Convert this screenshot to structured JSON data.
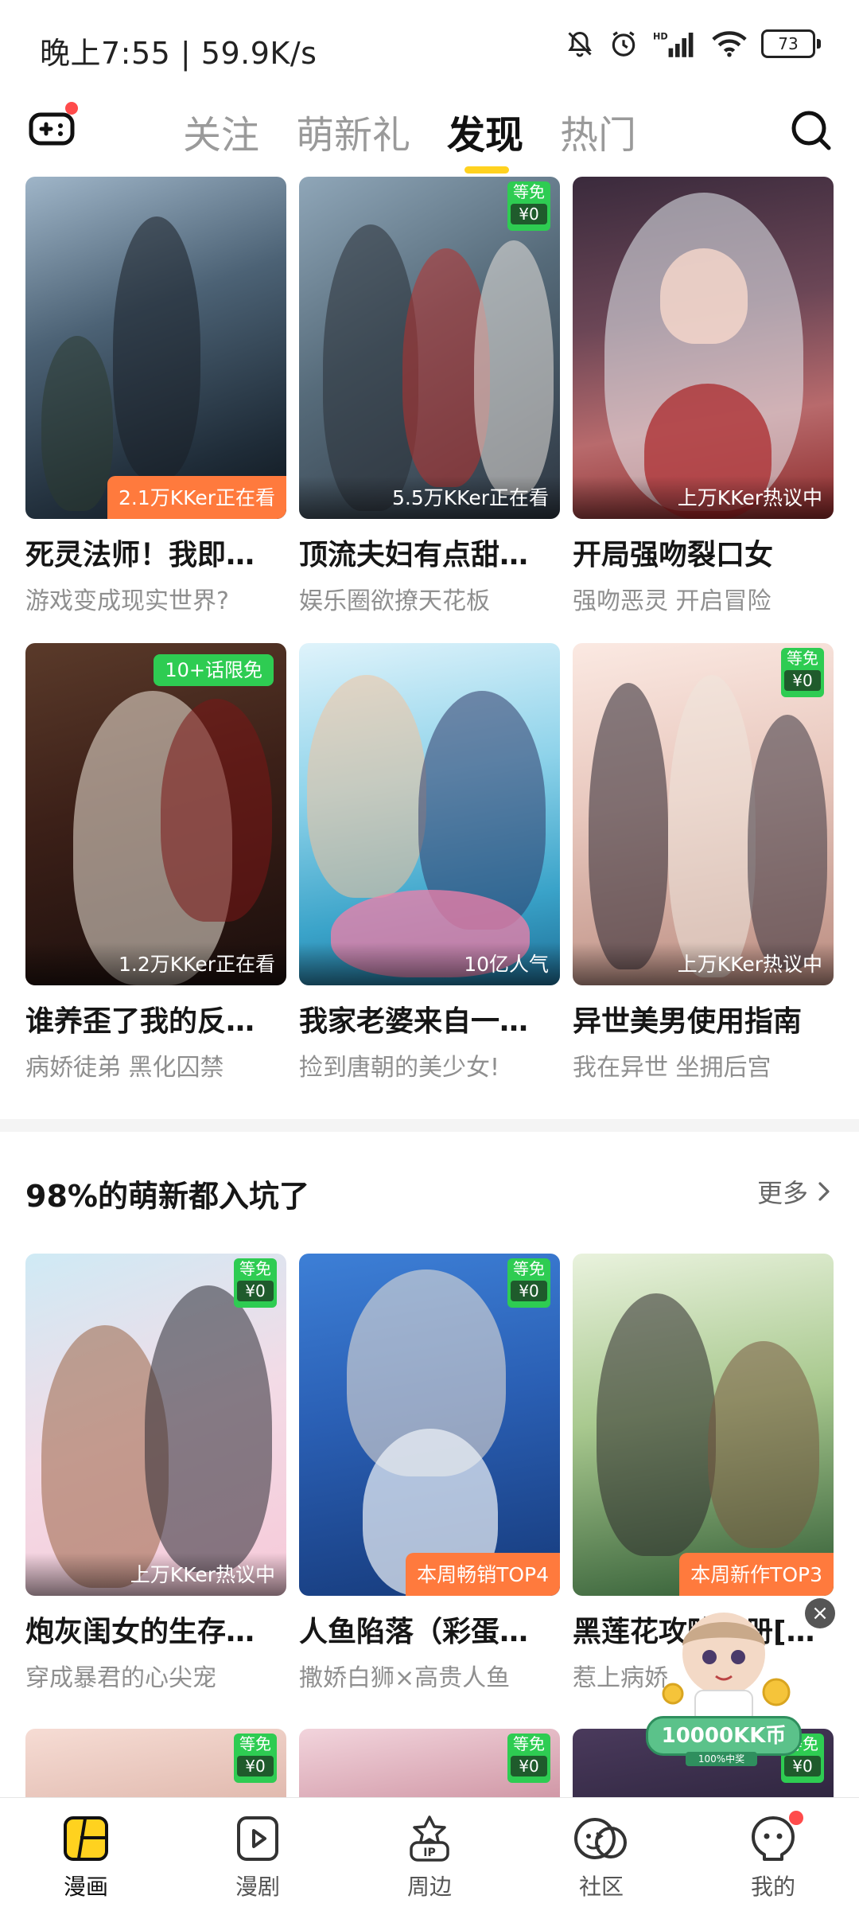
{
  "status_bar": {
    "time_speed": "晚上7:55 | 59.9K/s",
    "battery": "73"
  },
  "top_nav": {
    "tabs": [
      {
        "label": "关注"
      },
      {
        "label": "萌新礼"
      },
      {
        "label": "发现"
      },
      {
        "label": "热门"
      }
    ],
    "active_tab": "发现"
  },
  "grid": [
    {
      "title": "死灵法师！我即…",
      "subtitle": "游戏变成现实世界?",
      "watch_label": "2.1万KKer正在看",
      "label_style": "orange"
    },
    {
      "title": "顶流夫妇有点甜…",
      "subtitle": "娱乐圈欲撩天花板",
      "watch_label": "5.5万KKer正在看",
      "label_style": "plain",
      "free_top": "等免",
      "free_price": "¥0"
    },
    {
      "title": "开局强吻裂口女",
      "subtitle": "强吻恶灵 开启冒险",
      "watch_label": "上万KKer热议中",
      "label_style": "plain"
    },
    {
      "title": "谁养歪了我的反…",
      "subtitle": "病娇徒弟 黑化囚禁",
      "watch_label": "1.2万KKer正在看",
      "label_style": "plain",
      "limit_badge": "10+话限免"
    },
    {
      "title": "我家老婆来自一…",
      "subtitle": "捡到唐朝的美少女!",
      "watch_label": "10亿人气",
      "label_style": "plain"
    },
    {
      "title": "异世美男使用指南",
      "subtitle": "我在异世 坐拥后宫",
      "watch_label": "上万KKer热议中",
      "label_style": "plain",
      "free_top": "等免",
      "free_price": "¥0"
    }
  ],
  "section": {
    "title": "98%的萌新都入坑了",
    "more_label": "更多"
  },
  "section_cards": [
    {
      "title": "炮灰闺女的生存…",
      "subtitle": "穿成暴君的心尖宠",
      "watch_label": "上万KKer热议中",
      "label_style": "plain",
      "free_top": "等免",
      "free_price": "¥0"
    },
    {
      "title": "人鱼陷落（彩蛋…",
      "subtitle": "撒娇白狮×高贵人鱼",
      "watch_label": "本周畅销TOP4",
      "label_style": "orange",
      "free_top": "等免",
      "free_price": "¥0"
    },
    {
      "title": "黑莲花攻略手册[…",
      "subtitle": "惹上病娇",
      "watch_label": "本周新作TOP3",
      "label_style": "orange"
    }
  ],
  "partial_row": [
    {
      "free_top": "等免",
      "free_price": "¥0"
    },
    {
      "free_top": "等免",
      "free_price": "¥0"
    },
    {
      "free_top": "等免",
      "free_price": "¥0"
    }
  ],
  "promo": {
    "pill": "10000KK币",
    "sub": "100%中奖",
    "close": "×"
  },
  "bottom_nav": [
    {
      "label": "漫画",
      "icon": "comic-icon"
    },
    {
      "label": "漫剧",
      "icon": "video-play-icon"
    },
    {
      "label": "周边",
      "icon": "ip-merch-icon"
    },
    {
      "label": "社区",
      "icon": "community-icon"
    },
    {
      "label": "我的",
      "icon": "profile-icon"
    }
  ],
  "colors": {
    "accent": "#ffd21f",
    "free_badge": "#2ecc52",
    "orange_label": "#ff7a3d",
    "notify": "#ff4b4b"
  }
}
